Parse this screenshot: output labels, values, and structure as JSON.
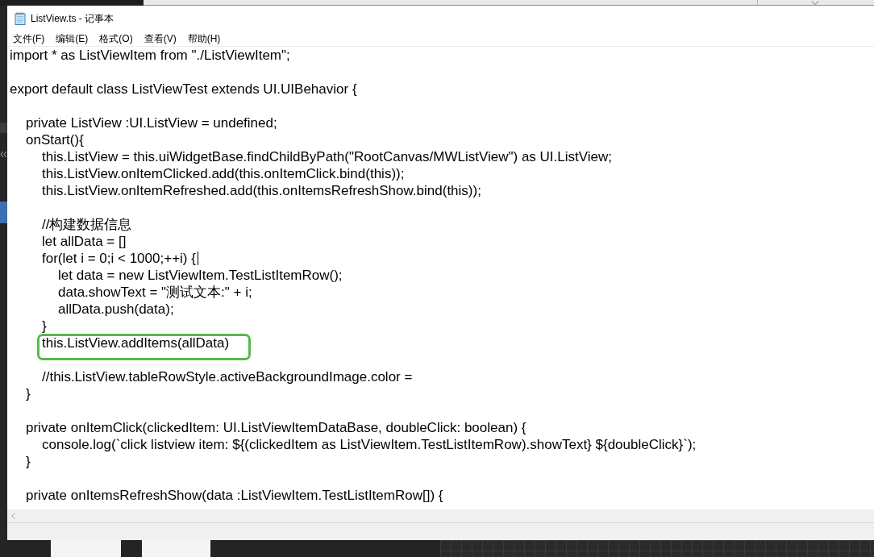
{
  "window": {
    "title": "ListView.ts - 记事本"
  },
  "menu": [
    "文件(F)",
    "编辑(E)",
    "格式(O)",
    "查看(V)",
    "帮助(H)"
  ],
  "editor": {
    "lines": [
      {
        "kind": "code",
        "text": "import * as ListViewItem from \"./ListViewItem\";",
        "highlighted": false,
        "caret": false
      },
      {
        "kind": "blank"
      },
      {
        "kind": "code",
        "text": "export default class ListViewTest extends UI.UIBehavior {",
        "highlighted": false,
        "caret": false,
        "children": [
          {
            "kind": "blank"
          },
          {
            "kind": "code",
            "text": "private ListView :UI.ListView = undefined;",
            "highlighted": false,
            "caret": false
          },
          {
            "kind": "code",
            "text": "onStart(){",
            "highlighted": false,
            "caret": false,
            "children": [
              {
                "kind": "code",
                "text": "this.ListView = this.uiWidgetBase.findChildByPath(\"RootCanvas/MWListView\") as UI.ListView;",
                "highlighted": false,
                "caret": false
              },
              {
                "kind": "code",
                "text": "this.ListView.onItemClicked.add(this.onItemClick.bind(this));",
                "highlighted": false,
                "caret": false
              },
              {
                "kind": "code",
                "text": "this.ListView.onItemRefreshed.add(this.onItemsRefreshShow.bind(this));",
                "highlighted": false,
                "caret": false
              },
              {
                "kind": "blank"
              },
              {
                "kind": "code",
                "text": "//构建数据信息",
                "highlighted": false,
                "caret": false
              },
              {
                "kind": "code",
                "text": "let allData = []",
                "highlighted": false,
                "caret": false
              },
              {
                "kind": "code",
                "text": "for(let i = 0;i < 1000;++i) {",
                "highlighted": false,
                "caret": true,
                "children": [
                  {
                    "kind": "code",
                    "text": "let data = new ListViewItem.TestListItemRow();",
                    "highlighted": false,
                    "caret": false
                  },
                  {
                    "kind": "code",
                    "text": "data.showText = \"测试文本:\" + i;",
                    "highlighted": false,
                    "caret": false
                  },
                  {
                    "kind": "code",
                    "text": "allData.push(data);",
                    "highlighted": false,
                    "caret": false
                  }
                ]
              },
              {
                "kind": "code",
                "text": "}",
                "highlighted": false,
                "caret": false
              },
              {
                "kind": "code",
                "text": "this.ListView.addItems(allData)",
                "highlighted": true,
                "caret": false
              },
              {
                "kind": "blank"
              },
              {
                "kind": "code",
                "text": "//this.ListView.tableRowStyle.activeBackgroundImage.color =",
                "highlighted": false,
                "caret": false
              }
            ]
          },
          {
            "kind": "code",
            "text": "}",
            "highlighted": false,
            "caret": false
          },
          {
            "kind": "blank"
          },
          {
            "kind": "code",
            "text": "private onItemClick(clickedItem: UI.ListViewItemDataBase, doubleClick: boolean) {",
            "highlighted": false,
            "caret": false,
            "children": [
              {
                "kind": "code",
                "text": "console.log(`click listview item: ${(clickedItem as ListViewItem.TestListItemRow).showText} ${doubleClick}`);",
                "highlighted": false,
                "caret": false
              }
            ]
          },
          {
            "kind": "code",
            "text": "}",
            "highlighted": false,
            "caret": false
          },
          {
            "kind": "blank"
          },
          {
            "kind": "code",
            "text": "private onItemsRefreshShow(data :ListViewItem.TestListItemRow[]) {",
            "highlighted": false,
            "caret": false
          }
        ]
      }
    ]
  }
}
